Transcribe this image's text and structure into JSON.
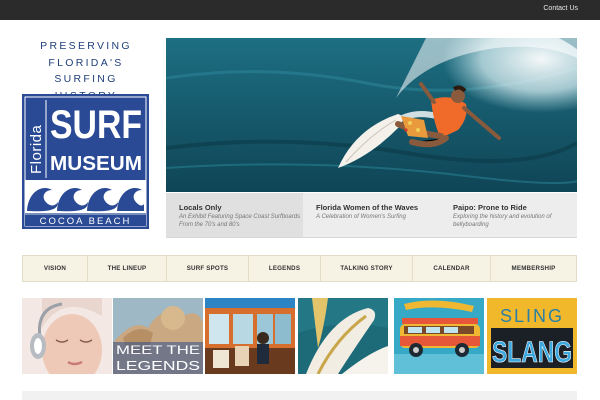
{
  "header": {
    "contact_label": "Contact Us"
  },
  "brand": {
    "tagline_lines": [
      "PRESERVING",
      "FLORIDA'S",
      "SURFING HISTORY"
    ],
    "logo_text": {
      "state": "Florida",
      "surf": "SURF",
      "museum": "MUSEUM",
      "location": "COCOA BEACH"
    }
  },
  "promos": [
    {
      "title": "Locals Only",
      "description": "An Exhibit Featuring Space Coast Surfboards From the 70's and 80's",
      "active": true
    },
    {
      "title": "Florida Women of the Waves",
      "description": "A Celebration of Women's Surfing",
      "active": false
    },
    {
      "title": "Paipo: Prone to Ride",
      "description": "Exploring the history and evolution of bellyboarding",
      "active": false
    }
  ],
  "nav": [
    "VISION",
    "THE LINEUP",
    "SURF SPOTS",
    "LEGENDS",
    "TALKING STORY",
    "CALENDAR",
    "MEMBERSHIP"
  ],
  "thumbnails": [
    {
      "name": "woman-headphones",
      "caption": ""
    },
    {
      "name": "meet-the-legends",
      "caption": "MEET THE LEGENDS",
      "lines": [
        "MEET THE",
        "LEGENDS"
      ]
    },
    {
      "name": "bus-interior",
      "caption": ""
    },
    {
      "name": "surfboard-fins",
      "caption": ""
    },
    {
      "name": "woody-wagon",
      "caption": ""
    },
    {
      "name": "sling-slang",
      "caption": "SLING SLANG",
      "lines": [
        "SLING",
        "SLANG"
      ]
    }
  ],
  "colors": {
    "brand_blue": "#1f3f7a",
    "logo_blue": "#2a4a95",
    "nav_bg": "#f6f2e4",
    "topbar": "#2b2b2b"
  }
}
